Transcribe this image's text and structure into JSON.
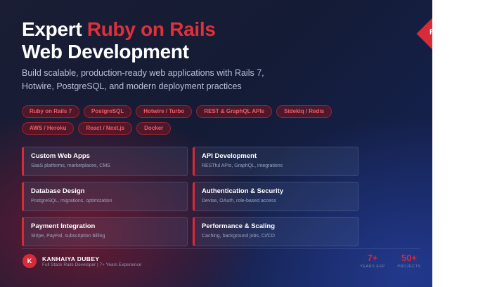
{
  "badge": {
    "letter": "R"
  },
  "title": {
    "prefix": "Expert ",
    "accent": "Ruby on Rails",
    "line2": "Web Development"
  },
  "subtitle": "Build scalable, production-ready web applications with Rails 7, Hotwire, PostgreSQL, and modern deployment practices",
  "tags": [
    "Ruby on Rails 7",
    "PostgreSQL",
    "Hotwire / Turbo",
    "REST & GraphQL APIs",
    "Sidekiq / Redis",
    "AWS / Heroku",
    "React / Next.js",
    "Docker"
  ],
  "cards": [
    {
      "title": "Custom Web Apps",
      "desc": "SaaS platforms, marketplaces, CMS"
    },
    {
      "title": "API Development",
      "desc": "RESTful APIs, GraphQL, integrations"
    },
    {
      "title": "Database Design",
      "desc": "PostgreSQL, migrations, optimization"
    },
    {
      "title": "Authentication & Security",
      "desc": "Devise, OAuth, role-based access"
    },
    {
      "title": "Payment Integration",
      "desc": "Stripe, PayPal, subscription billing"
    },
    {
      "title": "Performance & Scaling",
      "desc": "Caching, background jobs, CI/CD"
    }
  ],
  "author": {
    "initial": "K",
    "name": "KANHAIYA DUBEY",
    "role": "Full Stack Rails Developer | 7+ Years Experience"
  },
  "stats": {
    "years": {
      "value": "7+",
      "label": "YEARS EXP"
    },
    "projects": {
      "value": "50+",
      "label": "PROJECTS"
    }
  },
  "colors": {
    "accent": "#d72b37",
    "background_dark": "#141b35",
    "text_primary": "#ffffff",
    "text_muted": "#b9c1d6"
  }
}
